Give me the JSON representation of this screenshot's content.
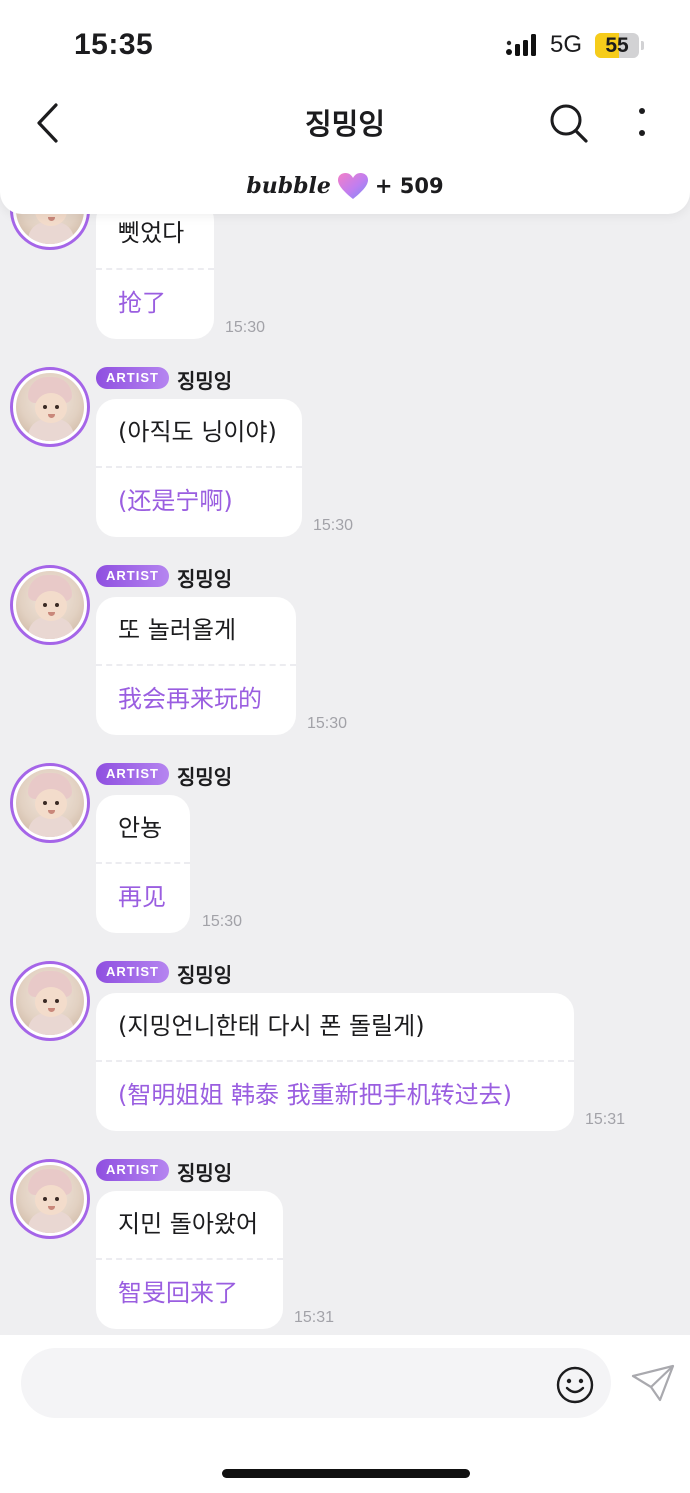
{
  "status_bar": {
    "time": "15:35",
    "network": "5G",
    "battery": "55",
    "battery_level": 0.55
  },
  "header": {
    "title": "징밍잉",
    "brand": "bubble",
    "brand_icon": "heart-icon",
    "subscriber_count": "+ 509",
    "icons": [
      "back-arrow-icon",
      "search-icon",
      "more-vertical-icon"
    ]
  },
  "messages": [
    {
      "sender": "징밍잉",
      "badge": "ARTIST",
      "original": "뻿었다",
      "translation": "抢了",
      "time": "15:30",
      "show_header": false
    },
    {
      "sender": "징밍잉",
      "badge": "ARTIST",
      "original": "(아직도 닝이야)",
      "translation": "(还是宁啊)",
      "time": "15:30",
      "show_header": true
    },
    {
      "sender": "징밍잉",
      "badge": "ARTIST",
      "original": " 또 놀러올게",
      "translation": "我会再来玩的",
      "time": "15:30",
      "show_header": true
    },
    {
      "sender": "징밍잉",
      "badge": "ARTIST",
      "original": "안뇽",
      "translation": "再见",
      "time": "15:30",
      "show_header": true
    },
    {
      "sender": "징밍잉",
      "badge": "ARTIST",
      "original": "(지밍언니한태 다시 폰 돌릴게)",
      "translation": "(智明姐姐 韩泰 我重新把手机转过去)",
      "time": "15:31",
      "show_header": true
    },
    {
      "sender": "징밍잉",
      "badge": "ARTIST",
      "original": "지민 돌아왔어",
      "translation": "智旻回来了",
      "time": "15:31",
      "show_header": true
    }
  ],
  "composer": {
    "input_value": "",
    "icons": [
      "emoji-icon",
      "send-icon"
    ]
  },
  "colors": {
    "accent": "#9a5ee0",
    "badge_gradient_start": "#8f4fe0",
    "badge_gradient_end": "#b585f0",
    "battery": "#f6cc1a",
    "background": "#efeff1"
  }
}
